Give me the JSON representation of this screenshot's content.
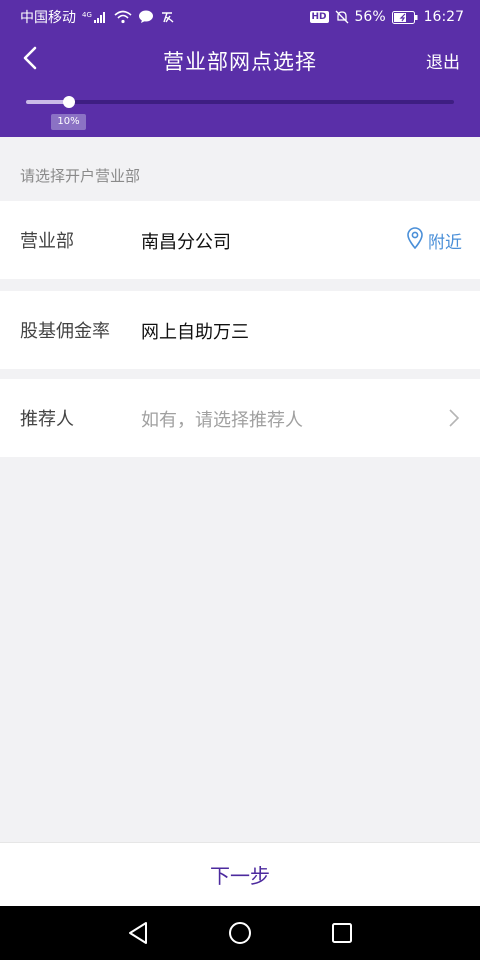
{
  "status_bar": {
    "carrier": "中国移动",
    "network": "4G",
    "battery_percent": "56%",
    "time": "16:27",
    "hd_badge": "HD"
  },
  "navbar": {
    "title": "营业部网点选择",
    "exit_label": "退出"
  },
  "progress": {
    "value": 0.1,
    "label": "10%"
  },
  "section_hint": "请选择开户营业部",
  "rows": [
    {
      "label": "营业部",
      "value": "南昌分公司",
      "action_label": "附近"
    },
    {
      "label": "股基佣金率",
      "value": "网上自助万三"
    },
    {
      "label": "推荐人",
      "placeholder": "如有，请选择推荐人"
    }
  ],
  "footer": {
    "next_label": "下一步"
  },
  "colors": {
    "header_bg": "#5a2fa8",
    "accent_link": "#4a8fd8",
    "next_text": "#4c2a9e"
  },
  "icons": [
    "back-arrow-icon",
    "location-pin-icon",
    "chevron-right-icon",
    "nav-back-icon",
    "nav-home-icon",
    "nav-recents-icon",
    "wifi-icon",
    "signal-icon",
    "chat-icon",
    "battery-icon",
    "mute-bell-icon"
  ]
}
